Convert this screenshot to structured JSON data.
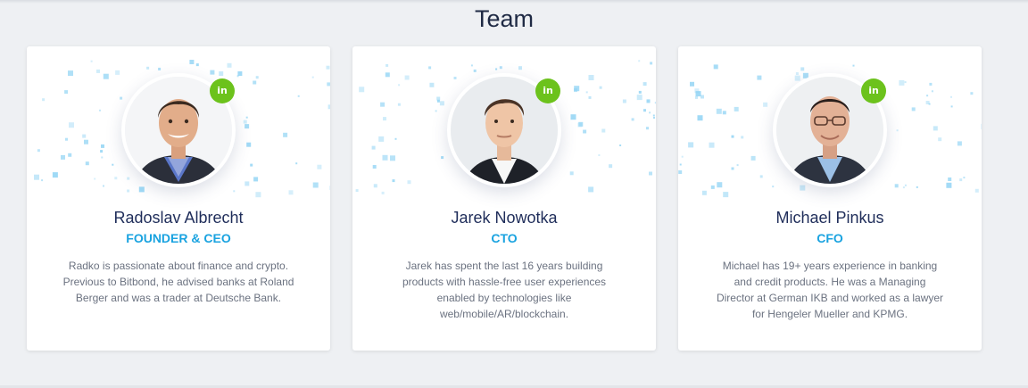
{
  "section": {
    "title": "Team"
  },
  "colors": {
    "background": "#eef0f3",
    "name": "#1f2d5a",
    "role": "#1aa3e0",
    "bio": "#6b7280",
    "linkedin": "#6cc21c",
    "pixels": "#8fd3f4"
  },
  "members": [
    {
      "name": "Radoslav Albrecht",
      "role": "FOUNDER & CEO",
      "bio": "Radko is passionate about finance and crypto. Previous to Bitbond, he advised banks at Roland Berger and was a trader at Deutsche Bank.",
      "linkedin_label": "in",
      "icon": "linkedin-icon"
    },
    {
      "name": "Jarek Nowotka",
      "role": "CTO",
      "bio": "Jarek has spent the last 16 years building products with hassle-free user experiences enabled by technologies like web/mobile/AR/blockchain.",
      "linkedin_label": "in",
      "icon": "linkedin-icon"
    },
    {
      "name": "Michael Pinkus",
      "role": "CFO",
      "bio": "Michael has 19+ years experience in banking and credit products. He was a Managing Director at German IKB and worked as a lawyer for Hengeler Mueller and KPMG.",
      "linkedin_label": "in",
      "icon": "linkedin-icon"
    }
  ]
}
